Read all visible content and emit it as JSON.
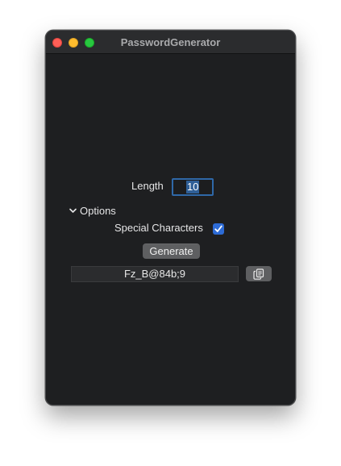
{
  "window": {
    "title": "PasswordGenerator"
  },
  "form": {
    "length_label": "Length",
    "length_value": "10",
    "options_label": "Options",
    "options_expanded": true,
    "special_characters_label": "Special Characters",
    "special_characters_checked": true,
    "generate_label": "Generate",
    "password_value": "Fz_B@84b;9"
  },
  "icons": {
    "close": "close-traffic-light",
    "minimize": "minimize-traffic-light",
    "zoom": "zoom-traffic-light",
    "disclosure": "chevron-down-icon",
    "checkmark": "checkmark-icon",
    "copy": "copy-icon"
  },
  "colors": {
    "window_bg": "#1e1f21",
    "accent": "#2d6bd6",
    "close": "#ff5f57",
    "minimize": "#febc2e",
    "zoom": "#28c840"
  }
}
